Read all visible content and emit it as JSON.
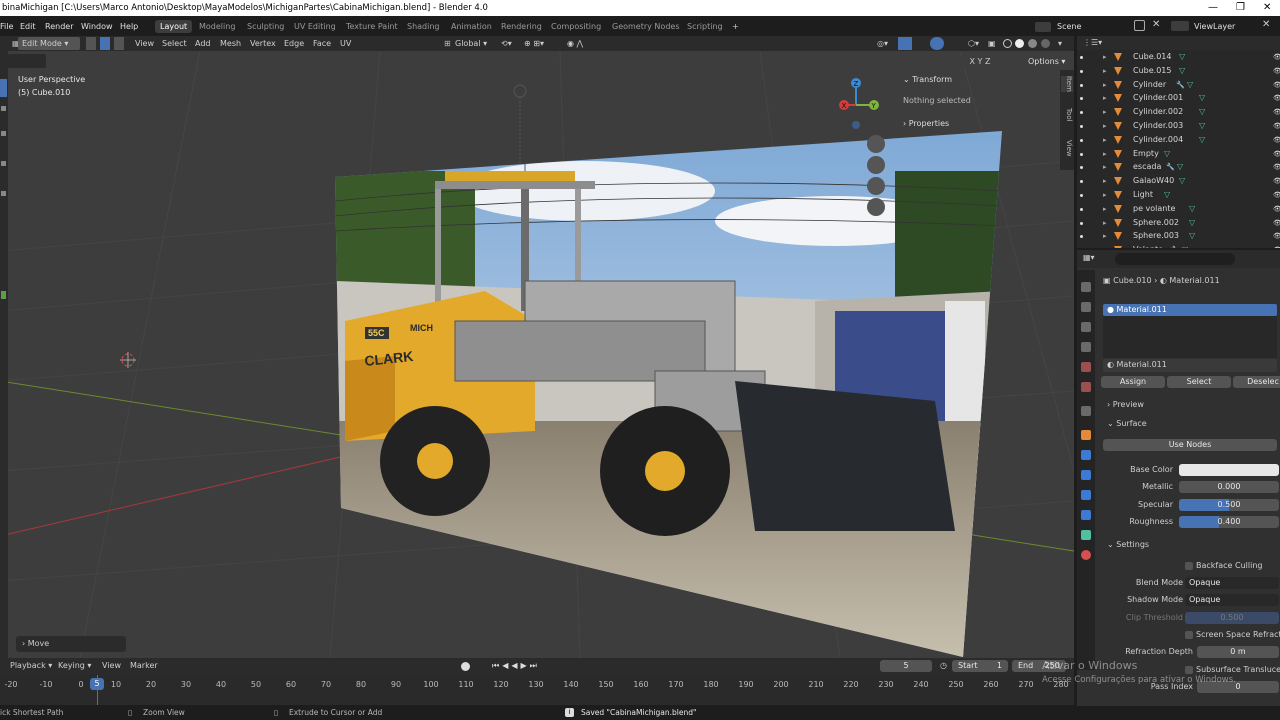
{
  "window": {
    "title": "binaMichigan [C:\\Users\\Marco Antonio\\Desktop\\MayaModelos\\MichiganPartes\\CabinaMichigan.blend] - Blender 4.0",
    "minimize": "—",
    "maximize": "❐",
    "close": "✕"
  },
  "menu": {
    "items": [
      "File",
      "Edit",
      "Render",
      "Window",
      "Help"
    ],
    "workspaces": [
      "Layout",
      "Modeling",
      "Sculpting",
      "UV Editing",
      "Texture Paint",
      "Shading",
      "Animation",
      "Rendering",
      "Compositing",
      "Geometry Nodes",
      "Scripting"
    ],
    "add_tab": "+",
    "scene_label": "Scene",
    "viewlayer_label": "ViewLayer"
  },
  "viewport_header": {
    "mode": "Edit Mode",
    "menus": [
      "View",
      "Select",
      "Add",
      "Mesh",
      "Vertex",
      "Edge",
      "Face",
      "UV"
    ],
    "orientation": "Global",
    "options": "Options",
    "axes": [
      "X",
      "Y",
      "Z"
    ]
  },
  "viewport": {
    "perspective": "User Perspective",
    "object": "(5) Cube.010",
    "operator_panel": "Move",
    "gizmo": {
      "x": "X",
      "y": "Y",
      "z": "Z"
    }
  },
  "npanel": {
    "transform": "Transform",
    "nothing_selected": "Nothing selected",
    "properties": "Properties",
    "tabs": [
      "Item",
      "Tool",
      "View"
    ]
  },
  "outliner": {
    "rows": [
      {
        "name": "Cube.014",
        "mod": false
      },
      {
        "name": "Cube.015",
        "mod": false
      },
      {
        "name": "Cylinder",
        "mod": true
      },
      {
        "name": "Cylinder.001",
        "mod": false
      },
      {
        "name": "Cylinder.002",
        "mod": false
      },
      {
        "name": "Cylinder.003",
        "mod": false
      },
      {
        "name": "Cylinder.004",
        "mod": false
      },
      {
        "name": "Empty",
        "mod": false
      },
      {
        "name": "escada",
        "mod": true
      },
      {
        "name": "GalaoW40",
        "mod": false
      },
      {
        "name": "Light",
        "mod": false
      },
      {
        "name": "pe volante",
        "mod": false
      },
      {
        "name": "Sphere.002",
        "mod": false
      },
      {
        "name": "Sphere.003",
        "mod": false
      },
      {
        "name": "Volante",
        "mod": true
      }
    ]
  },
  "properties": {
    "breadcrumb_object": "Cube.010",
    "breadcrumb_material": "Material.011",
    "slot": "Material.011",
    "material_name": "Material.011",
    "assign": "Assign",
    "select": "Select",
    "deselect": "Deselec",
    "preview": "Preview",
    "surface": "Surface",
    "use_nodes": "Use Nodes",
    "base_color_label": "Base Color",
    "base_color": "#e8e8e8",
    "metallic_label": "Metallic",
    "metallic": "0.000",
    "metallic_value": 0.0,
    "specular_label": "Specular",
    "specular": "0.500",
    "specular_value": 0.5,
    "roughness_label": "Roughness",
    "roughness": "0.400",
    "roughness_value": 0.4,
    "settings": "Settings",
    "backface_culling": "Backface Culling",
    "blend_mode_label": "Blend Mode",
    "blend_mode": "Opaque",
    "shadow_mode_label": "Shadow Mode",
    "shadow_mode": "Opaque",
    "clip_threshold_label": "Clip Threshold",
    "clip_threshold": "0.500",
    "screen_space_refraction": "Screen Space Refractio",
    "refraction_depth_label": "Refraction Depth",
    "refraction_depth": "0 m",
    "subsurface_translucency": "Subsurface Transluce",
    "pass_index_label": "Pass Index",
    "pass_index": "0"
  },
  "timeline": {
    "menus": [
      "Playback",
      "Keying",
      "View",
      "Marker"
    ],
    "current_frame": "5",
    "start_label": "Start",
    "start": "1",
    "end_label": "End",
    "end": "250",
    "ticks": [
      "-20",
      "-10",
      "0",
      "10",
      "20",
      "30",
      "40",
      "50",
      "60",
      "70",
      "80",
      "90",
      "100",
      "110",
      "120",
      "130",
      "140",
      "150",
      "160",
      "170",
      "180",
      "190",
      "200",
      "210",
      "220",
      "230",
      "240",
      "250",
      "260",
      "270",
      "280"
    ],
    "playhead": "5"
  },
  "statusbar": {
    "left": "ick Shortest Path",
    "zoom": "Zoom View",
    "extrude": "Extrude to Cursor or Add",
    "saved": "Saved \"CabinaMichigan.blend\""
  },
  "watermark": {
    "line1": "Ativar o Windows",
    "line2": "Acesse Configurações para ativar o Windows."
  },
  "colors": {
    "accent": "#4772b3",
    "active_highlight": "#4772b3",
    "x_axis": "#d43c3c",
    "y_axis": "#7fb53b",
    "z_axis": "#3c8ad4",
    "mesh_orange": "#e38a3b",
    "modifier_blue": "#50c0e0"
  },
  "image_plane_text": {
    "model": "55C",
    "brand": "CLARK",
    "brand2": "MICH"
  }
}
